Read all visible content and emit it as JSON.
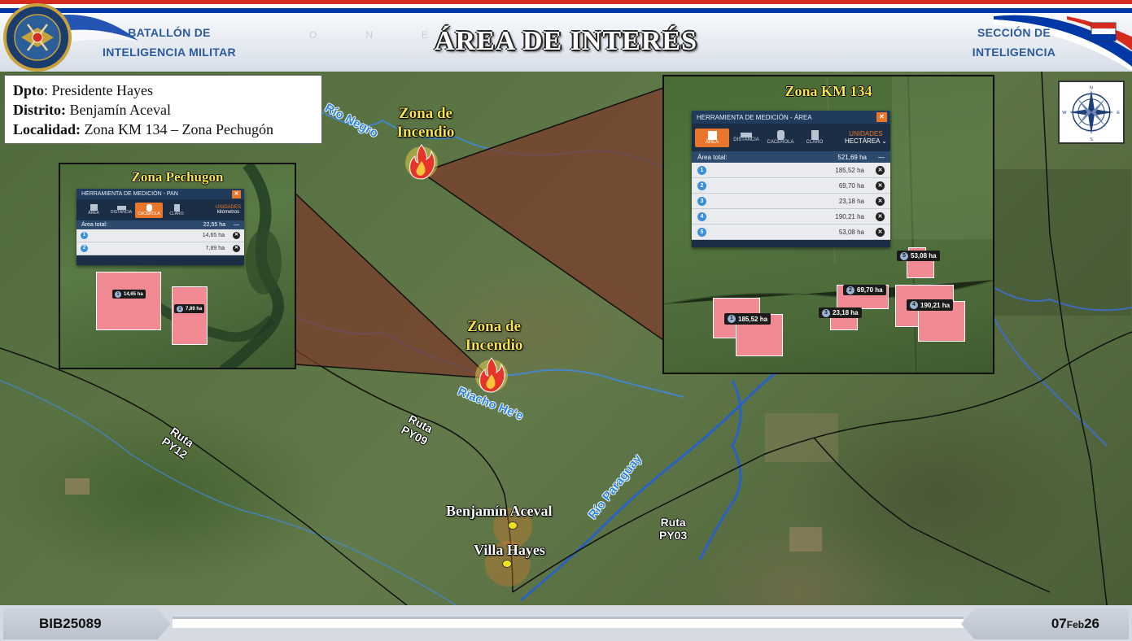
{
  "header": {
    "unit_left_line1": "BATALLÓN DE",
    "unit_left_line2": "INTELIGENCIA MILITAR",
    "title": "ÁREA DE INTERÉS",
    "unit_right_line1": "SECCIÓN DE",
    "unit_right_line2": "INTELIGENCIA",
    "emblem_text": "EJÉRCITO PARAGUAYO · BATALLÓN DE INTELIGENCIA MILITAR",
    "colors": {
      "flag_red": "#d52b1e",
      "flag_white": "#ffffff",
      "flag_blue": "#0038a8",
      "unit_text": "#2a5aa0"
    }
  },
  "info": {
    "dpto_label": "Dpto",
    "dpto_value": ": Presidente Hayes",
    "distrito_label": "Distrito:",
    "distrito_value": "Benjamín Aceval",
    "localidad_label": "Localidad:",
    "localidad_value": "Zona KM 134 – Zona Pechugón"
  },
  "map": {
    "fire_zone_1": {
      "line1": "Zona de",
      "line2": "Incendio"
    },
    "fire_zone_2": {
      "line1": "Zona de",
      "line2": "Incendio"
    },
    "rivers": {
      "negro": "Río Negro",
      "he_e": "Riacho He'e",
      "paraguay": "Río Paraguay"
    },
    "routes": {
      "py12": {
        "line1": "Ruta",
        "line2": "PY12"
      },
      "py09": {
        "line1": "Ruta",
        "line2": "PY09"
      },
      "py03": {
        "line1": "Ruta",
        "line2": "PY03"
      }
    },
    "towns": {
      "benjamin_aceval": "Benjamín Aceval",
      "villa_hayes": "Villa Hayes"
    },
    "compass": {
      "n": "N",
      "s": "S",
      "e": "E",
      "w": "W"
    },
    "colors": {
      "fire_label": "#f7e34a",
      "river_label": "#2d86e6",
      "polygon_fill": "#f28a93",
      "tool_accent": "#e8762b"
    }
  },
  "inset_pechugon": {
    "title": "Zona Pechugon",
    "tool": {
      "header": "HERRAMIENTA DE MEDICIÓN - PAN",
      "close": "✕",
      "buttons": [
        "ÁREA",
        "DISTANCIA",
        "CACEROLA",
        "CLARO"
      ],
      "units_label": "UNIDADES",
      "units_value": "kilómetros",
      "total_label": "Área total:",
      "total_value": "22,55 ha",
      "collapse": "—",
      "rows": [
        {
          "n": "1",
          "value": "14,65 ha"
        },
        {
          "n": "2",
          "value": "7,89 ha"
        }
      ]
    },
    "polygons": [
      {
        "n": "1",
        "label": "14,65 ha"
      },
      {
        "n": "2",
        "label": "7,89 ha"
      }
    ]
  },
  "inset_km134": {
    "title": "Zona KM 134",
    "tool": {
      "header": "HERRAMIENTA DE MEDICIÓN - ÁREA",
      "close": "✕",
      "buttons": [
        "ÁREA",
        "DISTANCIA",
        "CACEROLA",
        "CLARO"
      ],
      "units_label": "UNIDADES",
      "units_value": "HECTÁREA",
      "total_label": "Área total:",
      "total_value": "521,69 ha",
      "collapse": "—",
      "rows": [
        {
          "n": "1",
          "value": "185,52 ha"
        },
        {
          "n": "2",
          "value": "69,70 ha"
        },
        {
          "n": "3",
          "value": "23,18 ha"
        },
        {
          "n": "4",
          "value": "190,21 ha"
        },
        {
          "n": "5",
          "value": "53,08 ha"
        }
      ]
    },
    "polygons": [
      {
        "n": "1",
        "label": "185,52 ha"
      },
      {
        "n": "2",
        "label": "69,70 ha"
      },
      {
        "n": "3",
        "label": "23,18 ha"
      },
      {
        "n": "4",
        "label": "190,21 ha"
      },
      {
        "n": "5",
        "label": "53,08 ha"
      }
    ]
  },
  "footer": {
    "code": "BIB25089",
    "date_day": "07",
    "date_month": "Feb",
    "date_year": "26"
  }
}
